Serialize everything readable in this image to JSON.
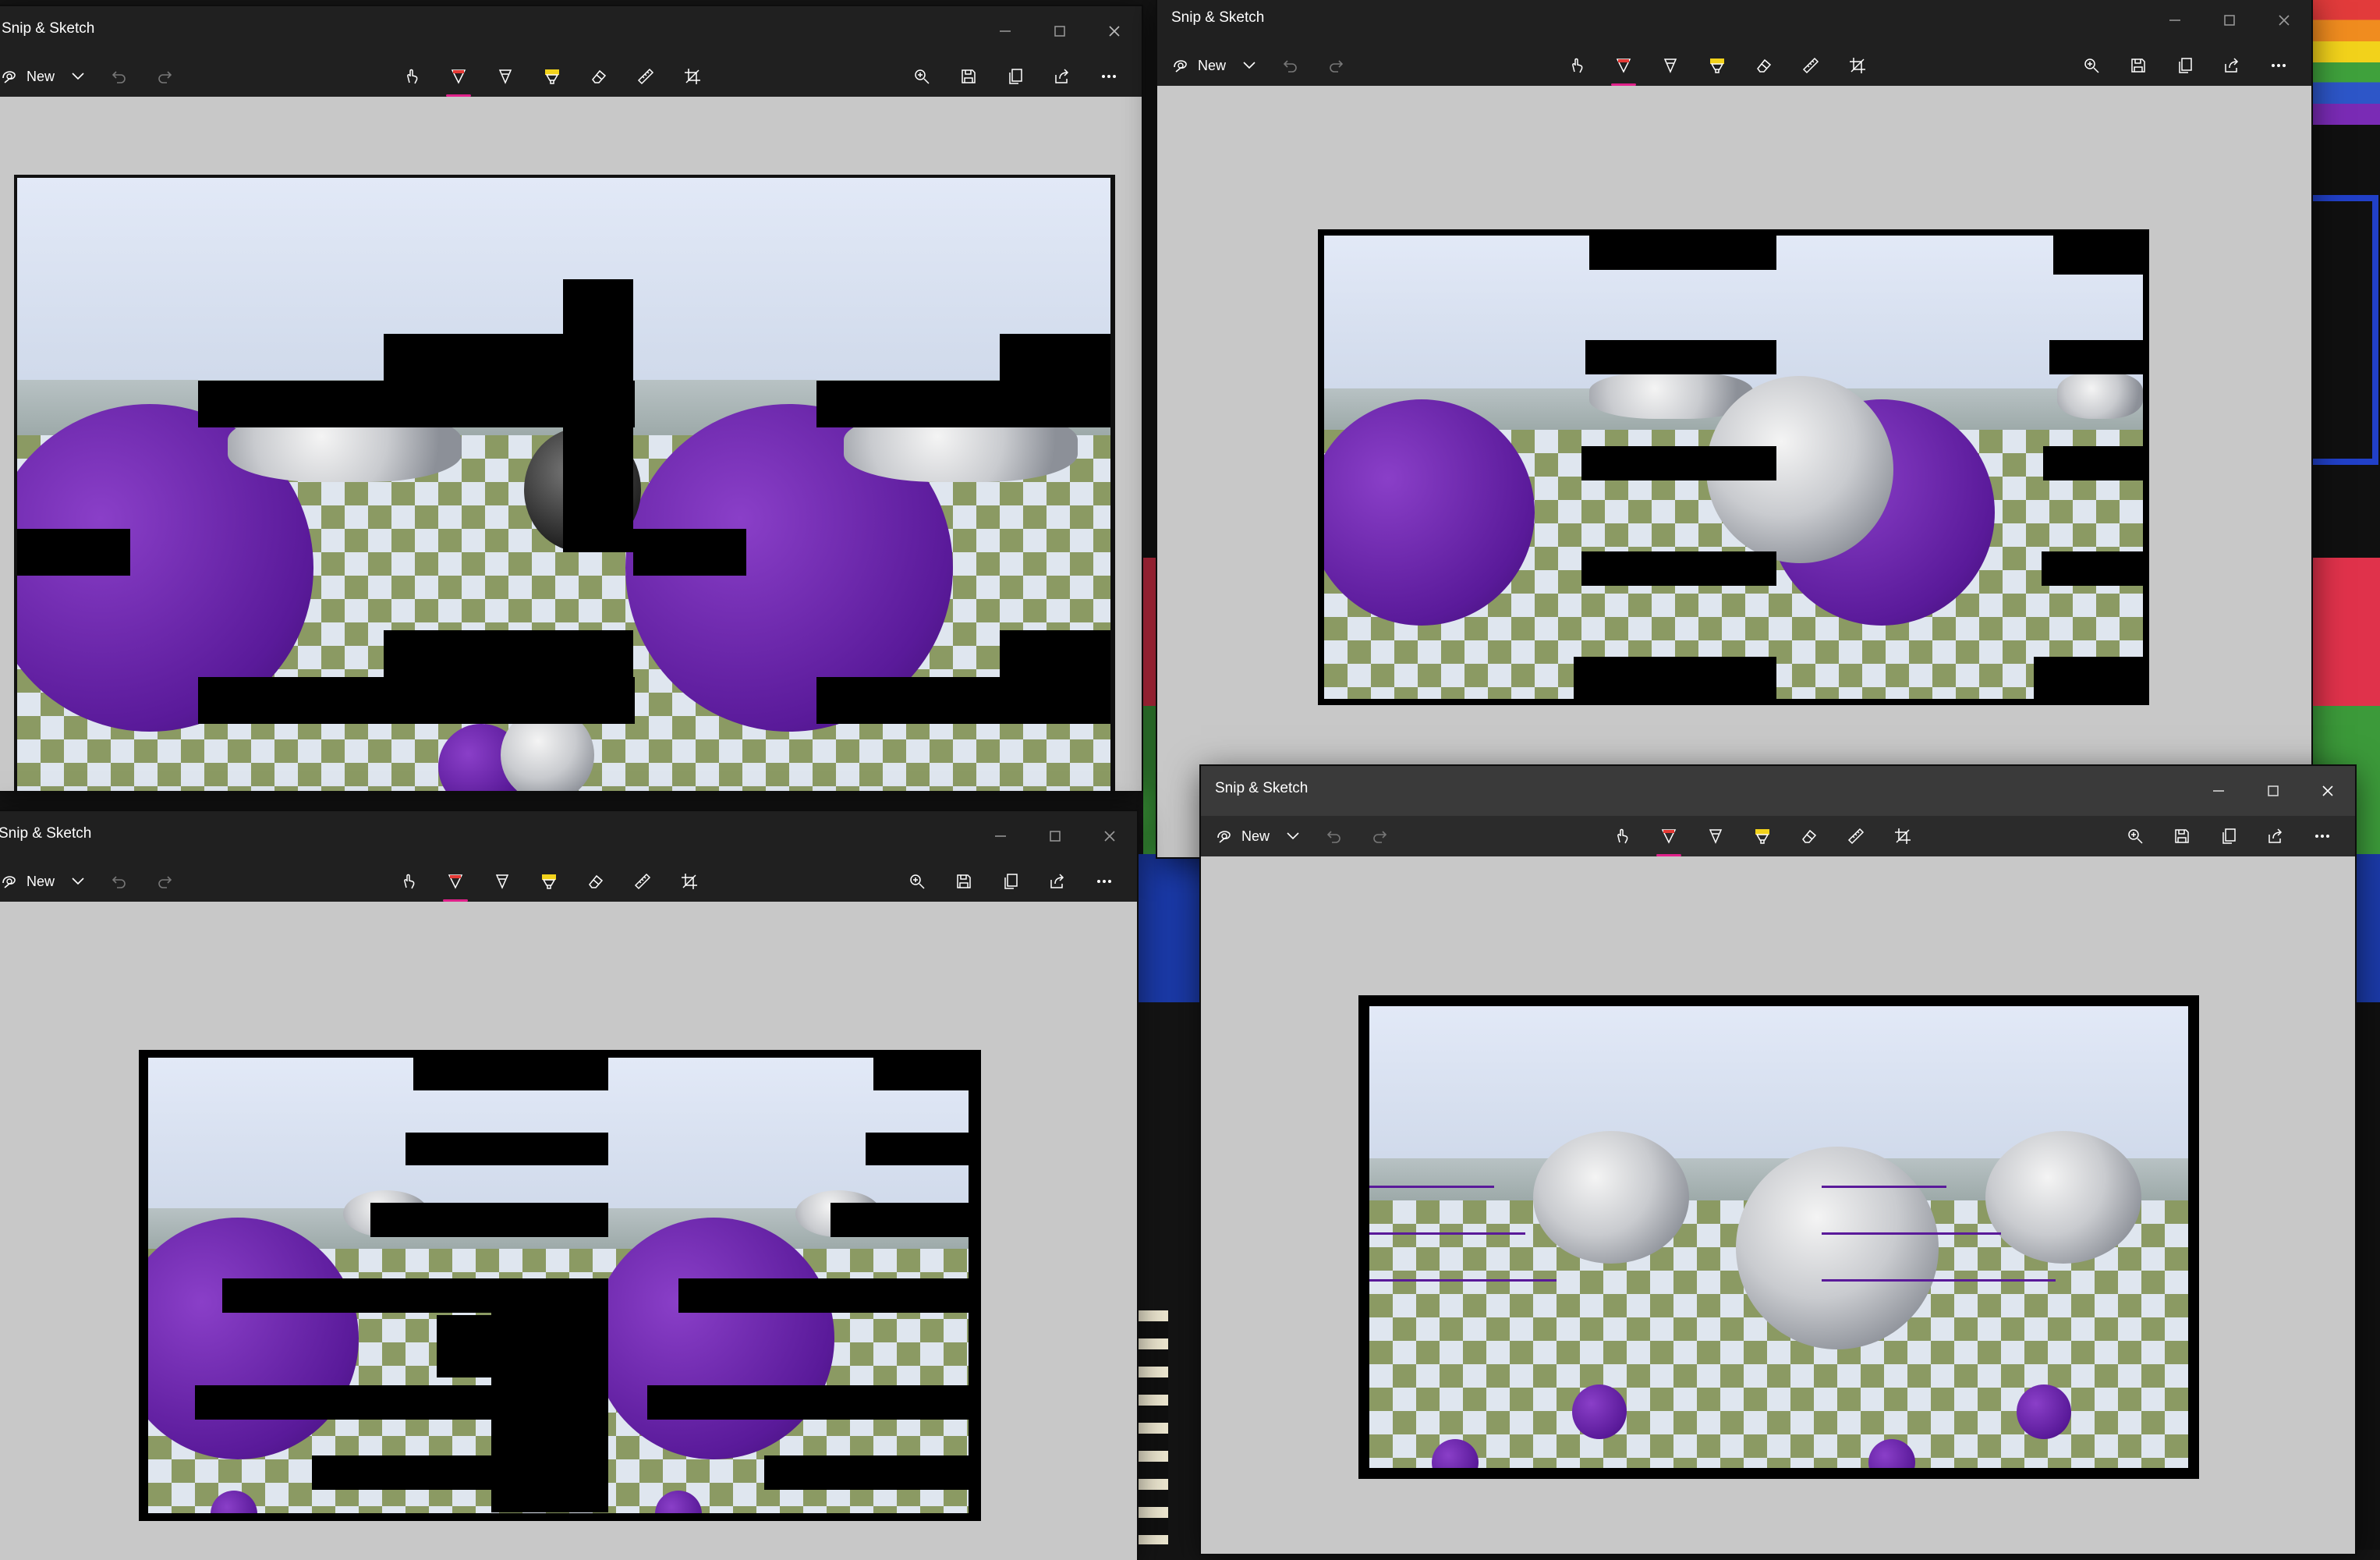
{
  "app": {
    "title": "Snip & Sketch",
    "new_label": "New"
  },
  "windows": [
    {
      "id": "top-left",
      "title": "Snip & Sketch",
      "new_label": "New"
    },
    {
      "id": "top-right",
      "title": "Snip & Sketch",
      "new_label": "New"
    },
    {
      "id": "bottom-left",
      "title": "Snip & Sketch",
      "new_label": "New"
    },
    {
      "id": "bottom-right",
      "title": "Snip & Sketch",
      "new_label": "New"
    }
  ],
  "toolbar_icons": {
    "left": [
      "new-snip-icon",
      "chevron-down-icon",
      "undo-icon",
      "redo-icon"
    ],
    "center": [
      "touch-writing-icon",
      "ballpoint-pen-icon",
      "pencil-icon",
      "highlighter-icon",
      "eraser-icon",
      "ruler-icon",
      "crop-icon"
    ],
    "right": [
      "zoom-icon",
      "save-icon",
      "copy-icon",
      "share-icon",
      "more-icon"
    ]
  },
  "colors": {
    "titlebar_bg": "#202020",
    "canvas_bg": "#c8c8c8",
    "pen_accent": "#e0218a",
    "pen_red": "#e53935",
    "highlighter_yellow": "#f2d21b",
    "render_purple": "#5a1a9a"
  }
}
